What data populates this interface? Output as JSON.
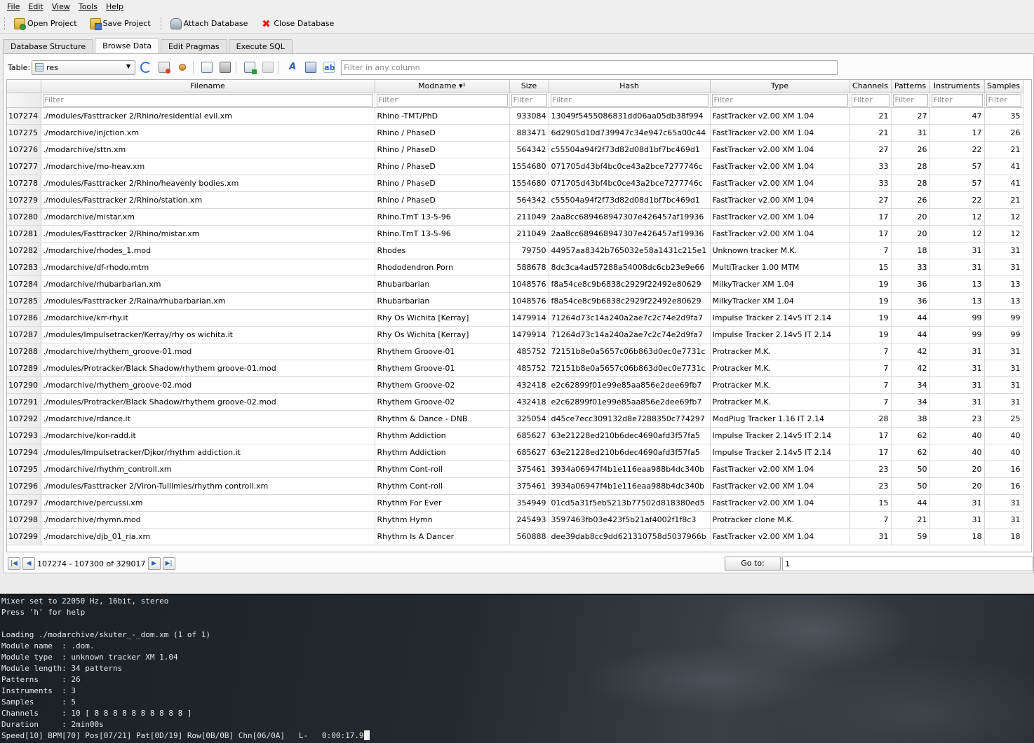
{
  "menubar": {
    "file": "File",
    "edit": "Edit",
    "view": "View",
    "tools": "Tools",
    "help": "Help"
  },
  "toolbar": {
    "open": "Open Project",
    "save": "Save Project",
    "attach": "Attach Database",
    "close": "Close Database"
  },
  "tabs": {
    "structure": "Database Structure",
    "browse": "Browse Data",
    "pragmas": "Edit Pragmas",
    "sql": "Execute SQL"
  },
  "browse": {
    "table_label": "Table:",
    "table_value": "res",
    "filter_placeholder": "Filter in any column",
    "column_filter_placeholder": "Filter",
    "columns": [
      "Filename",
      "Modname ▾¹",
      "Size",
      "Hash",
      "Type",
      "Channels",
      "Patterns",
      "Instruments",
      "Samples"
    ],
    "rows": [
      [
        "107274",
        "./modules/Fasttracker 2/Rhino/residential evil.xm",
        "Rhino -TMT/PhD",
        "933084",
        "13049f5455086831dd06aa05db38f994",
        "FastTracker v2.00 XM 1.04",
        "21",
        "27",
        "47",
        "35"
      ],
      [
        "107275",
        "./modarchive/injction.xm",
        "Rhino / PhaseD",
        "883471",
        "6d2905d10d739947c34e947c65a00c44",
        "FastTracker v2.00 XM 1.04",
        "21",
        "31",
        "17",
        "26"
      ],
      [
        "107276",
        "./modarchive/sttn.xm",
        "Rhino / PhaseD",
        "564342",
        "c55504a94f2f73d82d08d1bf7bc469d1",
        "FastTracker v2.00 XM 1.04",
        "27",
        "26",
        "22",
        "21"
      ],
      [
        "107277",
        "./modarchive/rno-heav.xm",
        "Rhino / PhaseD",
        "1554680",
        "071705d43bf4bc0ce43a2bce7277746c",
        "FastTracker v2.00 XM 1.04",
        "33",
        "28",
        "57",
        "41"
      ],
      [
        "107278",
        "./modules/Fasttracker 2/Rhino/heavenly bodies.xm",
        "Rhino / PhaseD",
        "1554680",
        "071705d43bf4bc0ce43a2bce7277746c",
        "FastTracker v2.00 XM 1.04",
        "33",
        "28",
        "57",
        "41"
      ],
      [
        "107279",
        "./modules/Fasttracker 2/Rhino/station.xm",
        "Rhino / PhaseD",
        "564342",
        "c55504a94f2f73d82d08d1bf7bc469d1",
        "FastTracker v2.00 XM 1.04",
        "27",
        "26",
        "22",
        "21"
      ],
      [
        "107280",
        "./modarchive/mistar.xm",
        "Rhino.TmT 13-5-96",
        "211049",
        "2aa8cc689468947307e426457af19936",
        "FastTracker v2.00 XM 1.04",
        "17",
        "20",
        "12",
        "12"
      ],
      [
        "107281",
        "./modules/Fasttracker 2/Rhino/mistar.xm",
        "Rhino.TmT 13-5-96",
        "211049",
        "2aa8cc689468947307e426457af19936",
        "FastTracker v2.00 XM 1.04",
        "17",
        "20",
        "12",
        "12"
      ],
      [
        "107282",
        "./modarchive/rhodes_1.mod",
        "Rhodes",
        "79750",
        "44957aa8342b765032e58a1431c215e1",
        "Unknown tracker M.K.",
        "7",
        "18",
        "31",
        "31"
      ],
      [
        "107283",
        "./modarchive/df-rhodo.mtm",
        "Rhododendron Porn",
        "588678",
        "8dc3ca4ad57288a54008dc6cb23e9e66",
        "MultiTracker 1.00 MTM",
        "15",
        "33",
        "31",
        "31"
      ],
      [
        "107284",
        "./modarchive/rhubarbarian.xm",
        "Rhubarbarian",
        "1048576",
        "f8a54ce8c9b6838c2929f22492e80629",
        "MilkyTracker XM 1.04",
        "19",
        "36",
        "13",
        "13"
      ],
      [
        "107285",
        "./modules/Fasttracker 2/Raina/rhubarbarian.xm",
        "Rhubarbarian",
        "1048576",
        "f8a54ce8c9b6838c2929f22492e80629",
        "MilkyTracker XM 1.04",
        "19",
        "36",
        "13",
        "13"
      ],
      [
        "107286",
        "./modarchive/krr-rhy.it",
        "Rhy Os Wichita    [Kerray]",
        "1479914",
        "71264d73c14a240a2ae7c2c74e2d9fa7",
        "Impulse Tracker 2.14v5 IT 2.14",
        "19",
        "44",
        "99",
        "99"
      ],
      [
        "107287",
        "./modules/Impulsetracker/Kerray/rhy os wichita.it",
        "Rhy Os Wichita    [Kerray]",
        "1479914",
        "71264d73c14a240a2ae7c2c74e2d9fa7",
        "Impulse Tracker 2.14v5 IT 2.14",
        "19",
        "44",
        "99",
        "99"
      ],
      [
        "107288",
        "./modarchive/rhythem_groove-01.mod",
        "Rhythem Groove-01",
        "485752",
        "72151b8e0a5657c06b863d0ec0e7731c",
        "Protracker M.K.",
        "7",
        "42",
        "31",
        "31"
      ],
      [
        "107289",
        "./modules/Protracker/Black Shadow/rhythem groove-01.mod",
        "Rhythem Groove-01",
        "485752",
        "72151b8e0a5657c06b863d0ec0e7731c",
        "Protracker M.K.",
        "7",
        "42",
        "31",
        "31"
      ],
      [
        "107290",
        "./modarchive/rhythem_groove-02.mod",
        "Rhythem Groove-02",
        "432418",
        "e2c62899f01e99e85aa856e2dee69fb7",
        "Protracker M.K.",
        "7",
        "34",
        "31",
        "31"
      ],
      [
        "107291",
        "./modules/Protracker/Black Shadow/rhythem groove-02.mod",
        "Rhythem Groove-02",
        "432418",
        "e2c62899f01e99e85aa856e2dee69fb7",
        "Protracker M.K.",
        "7",
        "34",
        "31",
        "31"
      ],
      [
        "107292",
        "./modarchive/rdance.it",
        "Rhythm & Dance - DNB",
        "325054",
        "d45ce7ecc309132d8e7288350c774297",
        "ModPlug Tracker 1.16 IT 2.14",
        "28",
        "38",
        "23",
        "25"
      ],
      [
        "107293",
        "./modarchive/kor-radd.it",
        "Rhythm Addiction",
        "685627",
        "63e21228ed210b6dec4690afd3f57fa5",
        "Impulse Tracker 2.14v5 IT 2.14",
        "17",
        "62",
        "40",
        "40"
      ],
      [
        "107294",
        "./modules/Impulsetracker/Djkor/rhythm addiction.it",
        "Rhythm Addiction",
        "685627",
        "63e21228ed210b6dec4690afd3f57fa5",
        "Impulse Tracker 2.14v5 IT 2.14",
        "17",
        "62",
        "40",
        "40"
      ],
      [
        "107295",
        "./modarchive/rhythm_controll.xm",
        "Rhythm Cont-roll",
        "375461",
        "3934a06947f4b1e116eaa988b4dc340b",
        "FastTracker v2.00 XM 1.04",
        "23",
        "50",
        "20",
        "16"
      ],
      [
        "107296",
        "./modules/Fasttracker 2/Viron-Tullimies/rhythm controll.xm",
        "Rhythm Cont-roll",
        "375461",
        "3934a06947f4b1e116eaa988b4dc340b",
        "FastTracker v2.00 XM 1.04",
        "23",
        "50",
        "20",
        "16"
      ],
      [
        "107297",
        "./modarchive/percussi.xm",
        "Rhythm For Ever",
        "354949",
        "01cd5a31f5eb5213b77502d818380ed5",
        "FastTracker v2.00 XM 1.04",
        "15",
        "44",
        "31",
        "31"
      ],
      [
        "107298",
        "./modarchive/rhymn.mod",
        "Rhythm Hymn",
        "245493",
        "3597463fb03e423f5b21af4002f1f8c3",
        "Protracker clone M.K.",
        "7",
        "21",
        "31",
        "31"
      ],
      [
        "107299",
        "./modarchive/djb_01_ria.xm",
        "Rhythm Is A Dancer",
        "560888",
        "dee39dab8cc9dd621310758d5037966b",
        "FastTracker v2.00 XM 1.04",
        "31",
        "59",
        "18",
        "18"
      ]
    ],
    "nav_label": "107274 - 107300 of 329017",
    "goto_label": "Go to:",
    "goto_value": "1"
  },
  "terminal": {
    "lines": [
      "Mixer set to 22050 Hz, 16bit, stereo",
      "Press 'h' for help",
      "",
      "Loading ./modarchive/skuter_-_dom.xm (1 of 1)",
      "Module name  : .dom.",
      "Module type  : unknown tracker XM 1.04",
      "Module length: 34 patterns",
      "Patterns     : 26",
      "Instruments  : 3",
      "Samples      : 5",
      "Channels     : 10 [ 8 8 8 8 8 8 8 8 8 8 ]",
      "Duration     : 2min00s"
    ],
    "status_line": "Speed[10] BPM[70] Pos[07/21] Pat[0D/19] Row[0B/0B] Chn[06/0A]   L-   0:00:17.9"
  }
}
